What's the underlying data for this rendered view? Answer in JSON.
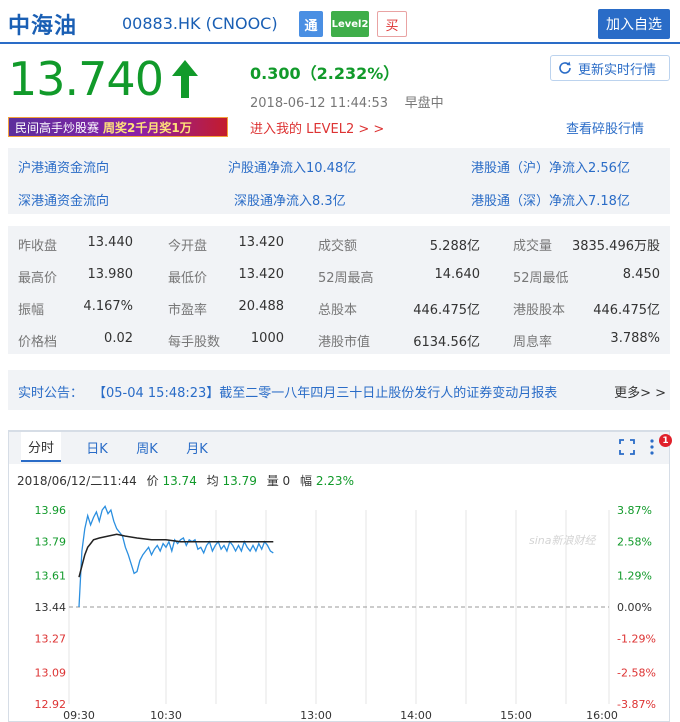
{
  "header": {
    "name": "中海油",
    "code": "00883.HK (CNOOC)",
    "badge_tong": "通",
    "badge_level2": "Level2",
    "badge_buy": "买",
    "add_button": "加入自选"
  },
  "quote": {
    "price": "13.740",
    "change": "0.300（2.232%）",
    "timestamp": "2018-06-12 11:44:53",
    "session": "早盘中",
    "refresh_button": "更新实时行情",
    "banner_a": "民间高手炒股赛",
    "banner_b": "周奖2千月奖1万",
    "level2_link": "进入我的 LEVEL2 > >",
    "odd_lot_link": "查看碎股行情",
    "up_color": "#119a2a"
  },
  "flows": [
    [
      "沪港通资金流向",
      "沪股通净流入10.48亿",
      "港股通（沪）净流入2.56亿"
    ],
    [
      "深港通资金流向",
      "深股通净流入8.3亿",
      "港股通（深）净流入7.18亿"
    ]
  ],
  "stats": [
    [
      [
        "昨收盘",
        "13.440"
      ],
      [
        "今开盘",
        "13.420"
      ],
      [
        "成交额",
        "5.288亿"
      ],
      [
        "成交量",
        "3835.496万股"
      ]
    ],
    [
      [
        "最高价",
        "13.980"
      ],
      [
        "最低价",
        "13.420"
      ],
      [
        "52周最高",
        "14.640"
      ],
      [
        "52周最低",
        "8.450"
      ]
    ],
    [
      [
        "振幅",
        "4.167%"
      ],
      [
        "市盈率",
        "20.488"
      ],
      [
        "总股本",
        "446.475亿"
      ],
      [
        "港股股本",
        "446.475亿"
      ]
    ],
    [
      [
        "价格档",
        "0.02"
      ],
      [
        "每手股数",
        "1000"
      ],
      [
        "港股市值",
        "6134.56亿"
      ],
      [
        "周息率",
        "3.788%"
      ]
    ]
  ],
  "notice": {
    "label": "实时公告：",
    "text": "【05-04 15:48:23】截至二零一八年四月三十日止股份发行人的证券变动月报表",
    "more": "更多> >"
  },
  "chart_tabs": [
    "分时",
    "日K",
    "周K",
    "月K"
  ],
  "chart_info": {
    "time": "2018/06/12/二11:44",
    "price_label": "价",
    "price": "13.74",
    "avg_label": "均",
    "avg": "13.79",
    "vol_label": "量",
    "vol": "0",
    "amp_label": "幅",
    "amp": "2.23%"
  },
  "badge_count": "1",
  "watermark": "sina新浪财经",
  "chart_data": {
    "type": "line",
    "title": "",
    "xlabel": "",
    "ylabel": "",
    "prev_close": 13.44,
    "ylim": [
      12.92,
      13.96
    ],
    "y_ticks": [
      "13.96",
      "13.79",
      "13.61",
      "13.44",
      "13.27",
      "13.09",
      "12.92"
    ],
    "y_ticks_right": [
      "3.87%",
      "2.58%",
      "1.29%",
      "0.00%",
      "-1.29%",
      "-2.58%",
      "-3.87%"
    ],
    "x_ticks": [
      "09:30",
      "10:30",
      "13:00",
      "14:00",
      "15:00",
      "16:00"
    ],
    "series": [
      {
        "name": "",
        "color": "#2b8fe0",
        "x": [
          "09:30",
          "09:32",
          "09:34",
          "09:36",
          "09:38",
          "09:40",
          "09:42",
          "09:44",
          "09:46",
          "09:48",
          "09:50",
          "09:52",
          "09:54",
          "09:56",
          "09:58",
          "10:00",
          "10:02",
          "10:04",
          "10:06",
          "10:08",
          "10:10",
          "10:12",
          "10:14",
          "10:16",
          "10:18",
          "10:20",
          "10:22",
          "10:24",
          "10:26",
          "10:28",
          "10:30",
          "10:32",
          "10:34",
          "10:36",
          "10:38",
          "10:40",
          "10:42",
          "10:44",
          "10:46",
          "10:48",
          "10:50",
          "10:52",
          "10:54",
          "10:56",
          "10:58",
          "11:00",
          "11:02",
          "11:04",
          "11:06",
          "11:08",
          "11:10",
          "11:12",
          "11:14",
          "11:16",
          "11:18",
          "11:20",
          "11:22",
          "11:24",
          "11:26",
          "11:28",
          "11:30",
          "11:32",
          "11:34",
          "11:36",
          "11:38",
          "11:40",
          "11:42",
          "11:44"
        ],
        "values": [
          13.44,
          13.74,
          13.86,
          13.93,
          13.88,
          13.92,
          13.95,
          13.9,
          13.96,
          13.98,
          13.94,
          13.96,
          13.9,
          13.86,
          13.84,
          13.82,
          13.76,
          13.72,
          13.67,
          13.62,
          13.63,
          13.69,
          13.72,
          13.74,
          13.76,
          13.72,
          13.75,
          13.77,
          13.74,
          13.78,
          13.76,
          13.79,
          13.74,
          13.8,
          13.78,
          13.8,
          13.81,
          13.77,
          13.8,
          13.79,
          13.8,
          13.75,
          13.76,
          13.73,
          13.77,
          13.79,
          13.74,
          13.77,
          13.79,
          13.75,
          13.77,
          13.74,
          13.79,
          13.77,
          13.74,
          13.77,
          13.74,
          13.79,
          13.76,
          13.74,
          13.77,
          13.74,
          13.78,
          13.75,
          13.79,
          13.77,
          13.74,
          13.73
        ]
      },
      {
        "name": "",
        "color": "#222222",
        "x": [
          "09:30",
          "09:32",
          "09:34",
          "09:36",
          "09:38",
          "09:40",
          "09:44",
          "09:50",
          "09:56",
          "10:02",
          "10:10",
          "10:20",
          "10:30",
          "10:40",
          "10:50",
          "11:00",
          "11:10",
          "11:20",
          "11:30",
          "11:44"
        ],
        "values": [
          13.6,
          13.66,
          13.72,
          13.76,
          13.78,
          13.8,
          13.81,
          13.82,
          13.83,
          13.82,
          13.81,
          13.8,
          13.8,
          13.79,
          13.79,
          13.79,
          13.79,
          13.79,
          13.79,
          13.79
        ]
      }
    ]
  }
}
